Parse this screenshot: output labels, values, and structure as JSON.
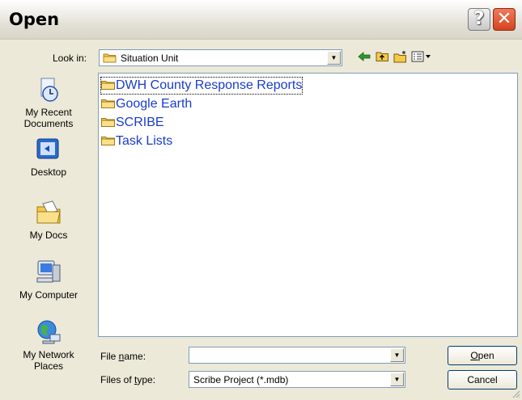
{
  "window": {
    "title": "Open",
    "help_glyph": "?",
    "close_glyph": "✕"
  },
  "lookin": {
    "label": "Look in:",
    "value": "Situation Unit",
    "toolbar_icons": [
      "back-icon",
      "up-folder-icon",
      "new-folder-icon",
      "views-menu-icon"
    ]
  },
  "places": [
    {
      "label": "My Recent Documents",
      "icon": "recent-documents-icon"
    },
    {
      "label": "Desktop",
      "icon": "desktop-icon"
    },
    {
      "label": "My Docs",
      "icon": "my-docs-icon"
    },
    {
      "label": "My Computer",
      "icon": "my-computer-icon"
    },
    {
      "label": "My Network Places",
      "icon": "network-places-icon"
    }
  ],
  "files": [
    {
      "name": "DWH County Response Reports",
      "type": "folder",
      "focused": true
    },
    {
      "name": "Google Earth",
      "type": "folder"
    },
    {
      "name": "SCRIBE",
      "type": "folder"
    },
    {
      "name": "Task Lists",
      "type": "folder"
    }
  ],
  "filename": {
    "label": "File name:",
    "value": ""
  },
  "filetype": {
    "label": "Files of type:",
    "value": "Scribe Project (*.mdb)"
  },
  "buttons": {
    "open": "Open",
    "cancel": "Cancel"
  },
  "colors": {
    "dialog_bg": "#ece9d8",
    "link_blue": "#1a3ccc",
    "folder_yellow": "#f5c84a",
    "close_red": "#d6431e"
  }
}
